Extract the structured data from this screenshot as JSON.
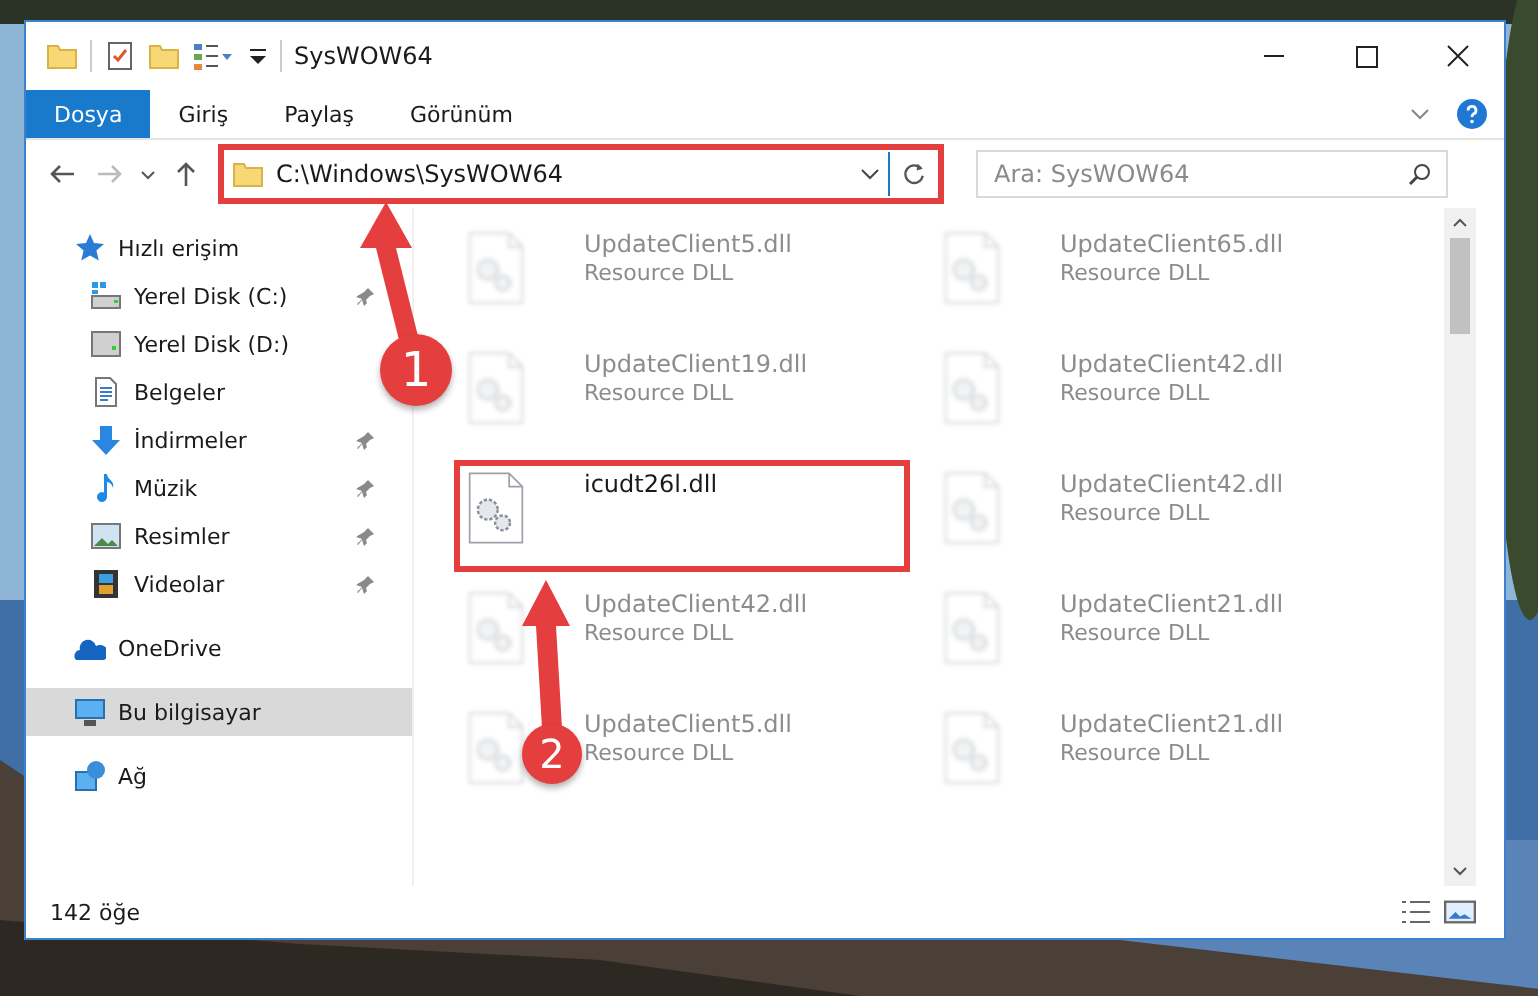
{
  "window": {
    "title": "SysWOW64"
  },
  "ribbon_tabs": [
    {
      "label": "Dosya",
      "selected": true
    },
    {
      "label": "Giriş",
      "selected": false
    },
    {
      "label": "Paylaş",
      "selected": false
    },
    {
      "label": "Görünüm",
      "selected": false
    }
  ],
  "address_bar": {
    "value": "C:\\Windows\\SysWOW64",
    "highlighted": true
  },
  "search": {
    "placeholder": "Ara: SysWOW64"
  },
  "sidebar": {
    "items": [
      {
        "label": "Hızlı erişim",
        "kind": "star",
        "selected": false,
        "children": [
          {
            "label": "Yerel Disk (C:)",
            "kind": "system-drive",
            "pinned": true,
            "selected": false
          },
          {
            "label": "Yerel Disk (D:)",
            "kind": "drive",
            "pinned": false,
            "selected": false
          },
          {
            "label": "Belgeler",
            "kind": "document",
            "pinned": false,
            "selected": false
          },
          {
            "label": "İndirmeler",
            "kind": "download",
            "pinned": true,
            "selected": false
          },
          {
            "label": "Müzik",
            "kind": "music",
            "pinned": true,
            "selected": false
          },
          {
            "label": "Resimler",
            "kind": "pictures",
            "pinned": true,
            "selected": false
          },
          {
            "label": "Videolar",
            "kind": "video",
            "pinned": true,
            "selected": false
          }
        ]
      },
      {
        "label": "OneDrive",
        "kind": "cloud",
        "selected": false
      },
      {
        "label": "Bu bilgisayar",
        "kind": "computer",
        "selected": true
      },
      {
        "label": "Ağ",
        "kind": "network",
        "selected": false
      }
    ]
  },
  "files": [
    {
      "name": "UpdateClient5.dll",
      "type": "Resource DLL",
      "blurred": true,
      "highlighted": false
    },
    {
      "name": "UpdateClient65.dll",
      "type": "Resource DLL",
      "blurred": true,
      "highlighted": false
    },
    {
      "name": "UpdateClient19.dll",
      "type": "Resource DLL",
      "blurred": true,
      "highlighted": false
    },
    {
      "name": "UpdateClient42.dll",
      "type": "Resource DLL",
      "blurred": true,
      "highlighted": false
    },
    {
      "name": "icudt26l.dll",
      "blurred": false,
      "highlighted": true
    },
    {
      "name": "UpdateClient42.dll",
      "type": "Resource DLL",
      "blurred": true,
      "highlighted": false
    },
    {
      "name": "UpdateClient42.dll",
      "type": "Resource DLL",
      "blurred": true,
      "highlighted": false
    },
    {
      "name": "UpdateClient21.dll",
      "type": "Resource DLL",
      "blurred": true,
      "highlighted": false
    },
    {
      "name": "UpdateClient5.dll",
      "type": "Resource DLL",
      "blurred": true,
      "highlighted": false
    },
    {
      "name": "UpdateClient21.dll",
      "type": "Resource DLL",
      "blurred": true,
      "highlighted": false
    }
  ],
  "status_bar": {
    "item_count": "142 öğe"
  },
  "callouts": [
    {
      "number": "1"
    },
    {
      "number": "2"
    }
  ]
}
